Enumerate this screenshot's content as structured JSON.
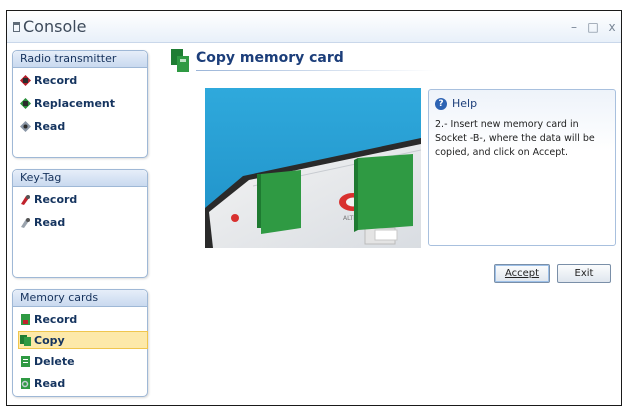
{
  "window": {
    "title": "Console",
    "controls": {
      "minimize": "–",
      "maximize": "□",
      "close": "x"
    }
  },
  "sidebar": {
    "radio": {
      "header": "Radio transmitter",
      "items": [
        {
          "label": "Record"
        },
        {
          "label": "Replacement"
        },
        {
          "label": "Read"
        }
      ]
    },
    "keytag": {
      "header": "Key-Tag",
      "items": [
        {
          "label": "Record"
        },
        {
          "label": "Read"
        }
      ]
    },
    "memory": {
      "header": "Memory cards",
      "items": [
        {
          "label": "Record"
        },
        {
          "label": "Copy",
          "selected": true
        },
        {
          "label": "Delete"
        },
        {
          "label": "Read"
        }
      ]
    }
  },
  "main": {
    "title": "Copy memory card",
    "photo_label": "ALTRO"
  },
  "help": {
    "title": "Help",
    "text": "2.- Insert new memory card in Socket -B-, where the data will be copied, and click on Accept."
  },
  "buttons": {
    "accept": "Accept",
    "exit": "Exit"
  },
  "colors": {
    "selected_bg": "#fde9a9",
    "panel_border": "#9fb8d6",
    "title": "#1c3e7a",
    "card_green": "#2f9a43"
  }
}
